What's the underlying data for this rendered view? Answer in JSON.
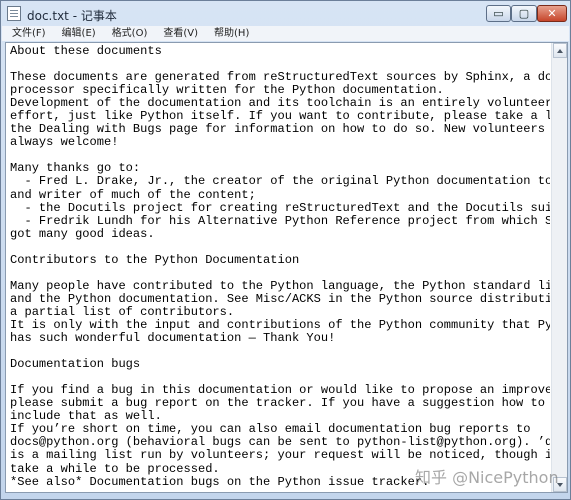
{
  "window": {
    "title": "doc.txt - 记事本",
    "minimize_label": "▭",
    "maximize_label": "▢",
    "close_label": "✕"
  },
  "menu": [
    {
      "label": "文件(F)"
    },
    {
      "label": "编辑(E)"
    },
    {
      "label": "格式(O)"
    },
    {
      "label": "查看(V)"
    },
    {
      "label": "帮助(H)"
    }
  ],
  "document": {
    "text": "About these documents\n\nThese documents are generated from reStructuredText sources by Sphinx, a document\nprocessor specifically written for the Python documentation.\nDevelopment of the documentation and its toolchain is an entirely volunteer\neffort, just like Python itself. If you want to contribute, please take a look at\nthe Dealing with Bugs page for information on how to do so. New volunteers are\nalways welcome!\n\nMany thanks go to:\n  - Fred L. Drake, Jr., the creator of the original Python documentation toolset\nand writer of much of the content;\n  - the Docutils project for creating reStructuredText and the Docutils suite;\n  - Fredrik Lundh for his Alternative Python Reference project from which Sphinx\ngot many good ideas.\n\nContributors to the Python Documentation\n\nMany people have contributed to the Python language, the Python standard library,\nand the Python documentation. See Misc/ACKS in the Python source distribution for\na partial list of contributors.\nIt is only with the input and contributions of the Python community that Python\nhas such wonderful documentation — Thank You!\n\nDocumentation bugs\n\nIf you find a bug in this documentation or would like to propose an improvement,\nplease submit a bug report on the tracker. If you have a suggestion how to fix it,\ninclude that as well.\nIf you’re short on time, you can also email documentation bug reports to\ndocs@python.org (behavioral bugs can be sent to python-list@python.org). ’docs@’\nis a mailing list run by volunteers; your request will be noticed, though it may\ntake a while to be processed.\n*See also* Documentation bugs on the Python issue tracker."
  },
  "watermark": "知乎 @NicePython"
}
